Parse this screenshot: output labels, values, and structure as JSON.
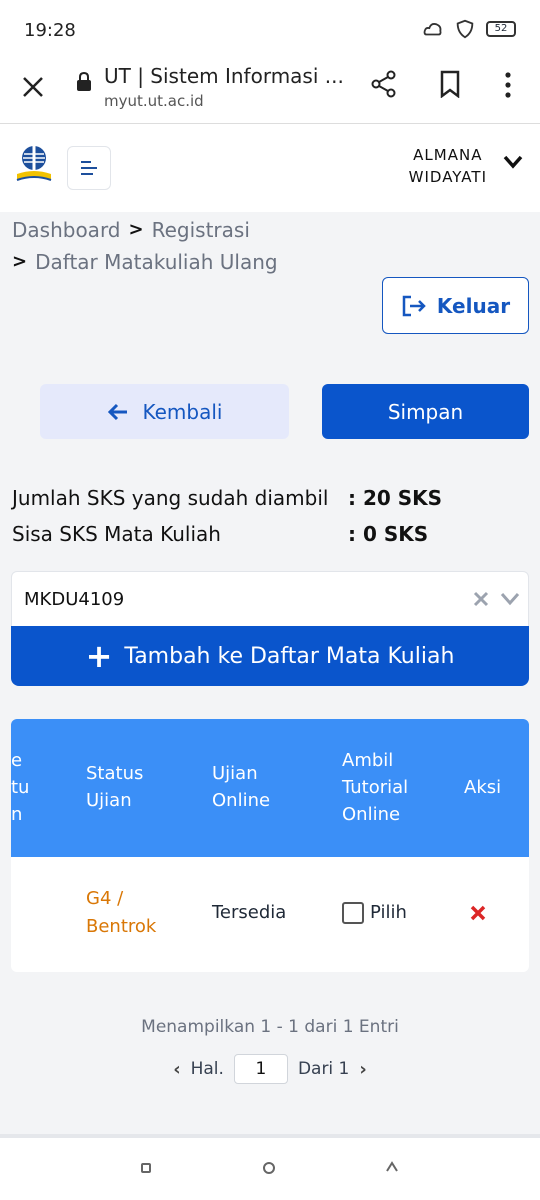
{
  "status_bar": {
    "time": "19:28",
    "battery": "52"
  },
  "browser": {
    "title": "UT | Sistem Informasi ...",
    "url": "myut.ut.ac.id"
  },
  "header": {
    "user_line1": "ALMANA",
    "user_line2": "WIDAYATI"
  },
  "breadcrumb": {
    "items": [
      "Dashboard",
      "Registrasi",
      "Daftar Matakuliah Ulang"
    ]
  },
  "buttons": {
    "keluar": "Keluar",
    "kembali": "Kembali",
    "simpan": "Simpan",
    "tambah": "Tambah ke Daftar Mata Kuliah"
  },
  "sks": {
    "taken_label": "Jumlah SKS yang sudah diambil",
    "taken_value": ": 20 SKS",
    "remaining_label": "Sisa SKS Mata Kuliah",
    "remaining_value": ": 0 SKS"
  },
  "course_select": {
    "value": "MKDU4109"
  },
  "table": {
    "headers": {
      "partial_line1": "e",
      "partial_line2": "tu",
      "partial_line3": "n",
      "status_ujian_1": "Status",
      "status_ujian_2": "Ujian",
      "ujian_online_1": "Ujian",
      "ujian_online_2": "Online",
      "ambil_1": "Ambil",
      "ambil_2": "Tutorial",
      "ambil_3": "Online",
      "aksi": "Aksi"
    },
    "rows": [
      {
        "status_1": "G4 /",
        "status_2": "Bentrok",
        "ujian_online": "Tersedia",
        "pilih": "Pilih"
      }
    ]
  },
  "pagination": {
    "info": "Menampilkan 1 - 1 dari 1 Entri",
    "hal_label": "Hal.",
    "page": "1",
    "dari": "Dari 1"
  },
  "colors": {
    "primary": "#0a55cc",
    "table_head": "#3b8ff7",
    "warning": "#d97706",
    "danger": "#dc2626"
  }
}
